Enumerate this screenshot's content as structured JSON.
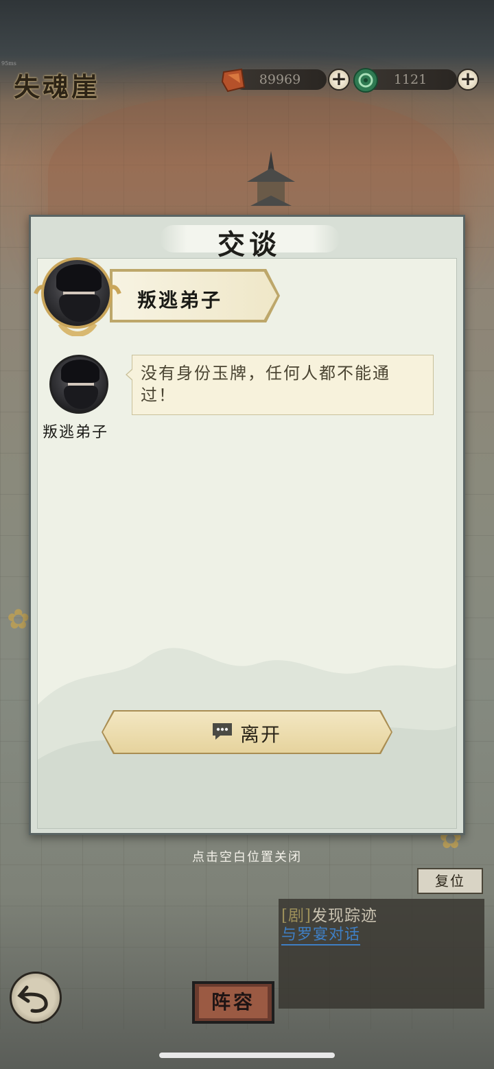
{
  "header": {
    "location": "失魂崖",
    "corner_tag": "95ms"
  },
  "resources": [
    {
      "name": "ore",
      "value": "89969",
      "icon": "ore-icon"
    },
    {
      "name": "jade",
      "value": "1121",
      "icon": "jade-coin-icon"
    }
  ],
  "dialog": {
    "title": "交谈",
    "speaker_banner_name": "叛逃弟子",
    "speaker_label": "叛逃弟子",
    "message": "没有身份玉牌，任何人都不能通过！",
    "leave_label": "离开"
  },
  "close_hint": "点击空白位置关闭",
  "reset_label": "复位",
  "quest": {
    "tag": "[剧]",
    "title": "发现踪迹",
    "objective": "与罗宴对话"
  },
  "bottom": {
    "lineup_label": "阵容"
  },
  "colors": {
    "accent_gold": "#c9a55a",
    "quest_link": "#3f7fc4"
  }
}
